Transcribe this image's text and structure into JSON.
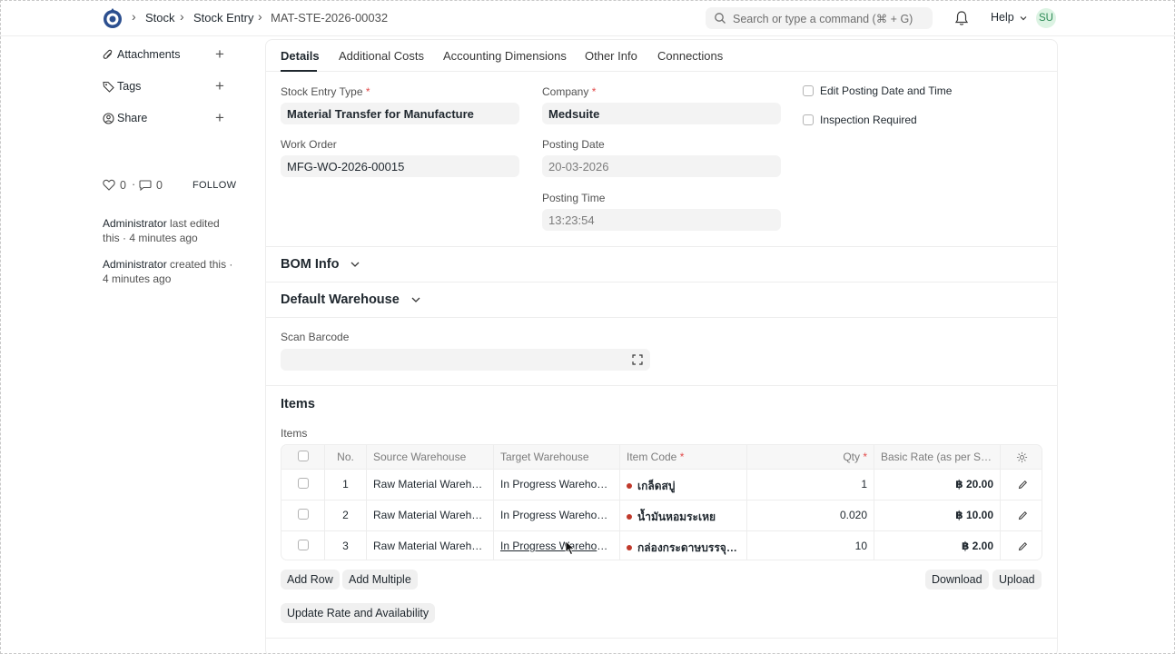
{
  "navbar": {
    "breadcrumbs": [
      "Stock",
      "Stock Entry",
      "MAT-STE-2026-00032"
    ],
    "search_placeholder": "Search or type a command (⌘ + G)",
    "help_label": "Help",
    "avatar_initials": "SU"
  },
  "sidebar": {
    "attachments_label": "Attachments",
    "tags_label": "Tags",
    "share_label": "Share",
    "likes_count": "0",
    "comments_count": "0",
    "dot": "·",
    "follow_label": "FOLLOW",
    "activity": [
      {
        "user": "Administrator",
        "text": "last edited this · 4 minutes ago"
      },
      {
        "user": "Administrator",
        "text": "created this · 4 minutes ago"
      }
    ]
  },
  "tabs": [
    "Details",
    "Additional Costs",
    "Accounting Dimensions",
    "Other Info",
    "Connections"
  ],
  "form": {
    "stock_entry_type_label": "Stock Entry Type",
    "stock_entry_type_value": "Material Transfer for Manufacture",
    "work_order_label": "Work Order",
    "work_order_value": "MFG-WO-2026-00015",
    "company_label": "Company",
    "company_value": "Medsuite",
    "posting_date_label": "Posting Date",
    "posting_date_value": "20-03-2026",
    "posting_time_label": "Posting Time",
    "posting_time_value": "13:23:54",
    "edit_posting_label": "Edit Posting Date and Time",
    "inspection_label": "Inspection Required",
    "required_mark": "*"
  },
  "sections": {
    "bom_info": "BOM Info",
    "default_warehouse": "Default Warehouse",
    "scan_barcode_label": "Scan Barcode",
    "items_title": "Items",
    "items_label": "Items"
  },
  "grid": {
    "headers": {
      "no": "No.",
      "source": "Source Warehouse",
      "target": "Target Warehouse",
      "item_code": "Item Code",
      "qty": "Qty",
      "rate": "Basic Rate (as per Sto..."
    },
    "rows": [
      {
        "no": "1",
        "source": "Raw Material Warehou...",
        "target": "In Progress Warehous...",
        "item": "เกล็ดสบู่",
        "qty": "1",
        "rate": "฿ 20.00"
      },
      {
        "no": "2",
        "source": "Raw Material Warehou...",
        "target": "In Progress Warehous...",
        "item": "น้ำมันหอมระเหย",
        "qty": "0.020",
        "rate": "฿ 10.00"
      },
      {
        "no": "3",
        "source": "Raw Material Warehou...",
        "target": "In Progress Warehous...",
        "item": "กล่องกระดาษบรรจุภัณฑ์",
        "qty": "10",
        "rate": "฿ 2.00"
      }
    ]
  },
  "buttons": {
    "add_row": "Add Row",
    "add_multiple": "Add Multiple",
    "download": "Download",
    "upload": "Upload",
    "update_rate": "Update Rate and Availability"
  },
  "icons": {
    "logo": "logo-icon",
    "search": "search-icon",
    "bell": "bell-icon",
    "paperclip": "paperclip-icon",
    "tag": "tag-icon",
    "share": "share-icon",
    "heart": "heart-icon",
    "comment": "comment-icon",
    "fullscreen": "fullscreen-icon",
    "pencil": "pencil-icon",
    "gear": "gear-icon"
  },
  "colors": {
    "accent_text": "#1f272e",
    "field_bg": "#f3f3f3",
    "required": "#e24c4c",
    "status_dot": "#c0392b",
    "avatar_bg": "#dcf3e3",
    "avatar_text": "#2e8b57"
  }
}
